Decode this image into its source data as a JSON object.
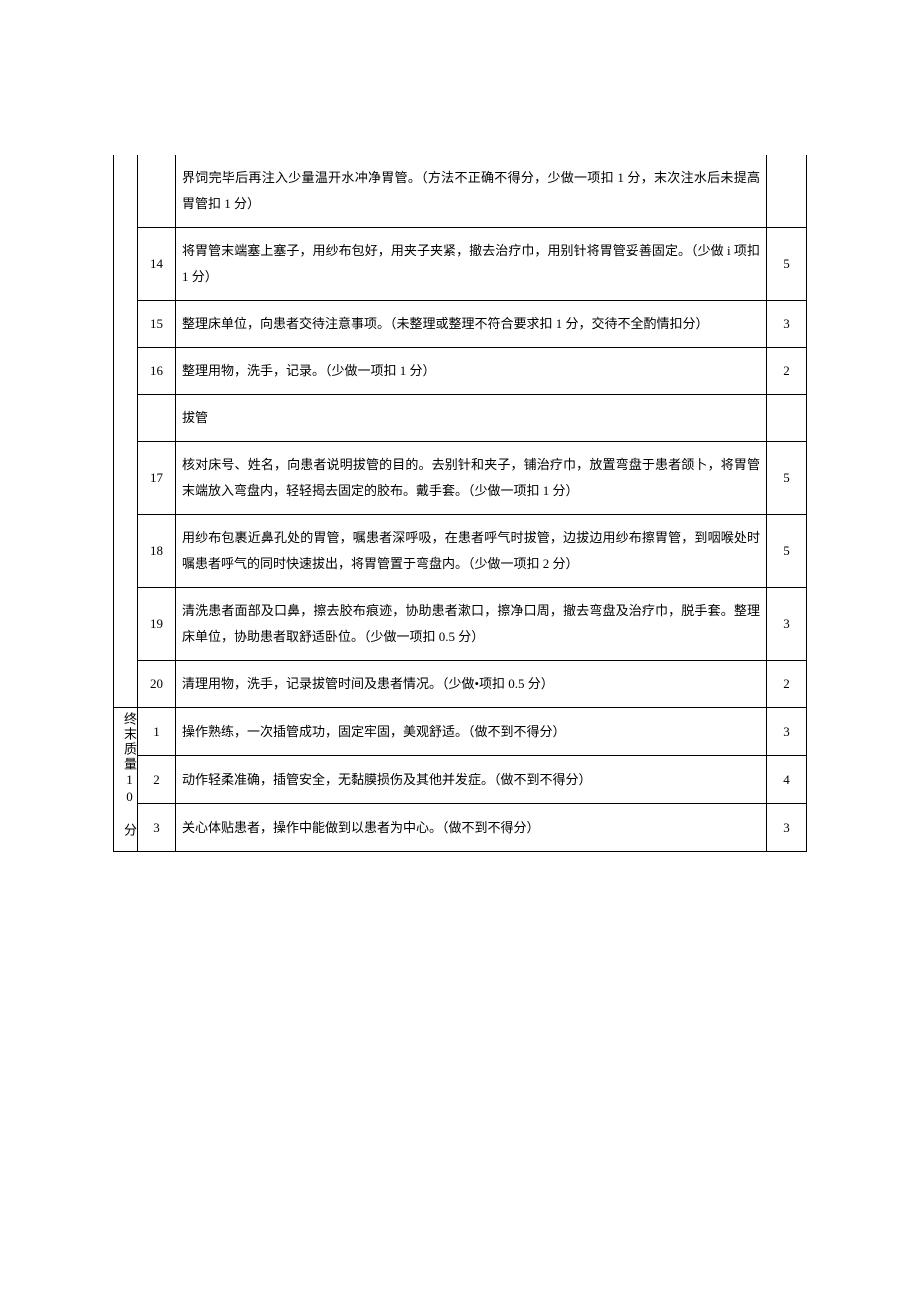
{
  "sections": {
    "main_continued": {
      "rows": [
        {
          "num": "",
          "content": "界饲完毕后再注入少量温开水冲净胃管。（方法不正确不得分，少做一项扣 1 分，末次注水后未提高胃管扣 1 分）",
          "score": ""
        },
        {
          "num": "14",
          "content": "将胃管末端塞上塞子，用纱布包好，用夹子夹紧，撤去治疗巾，用别针将胃管妥善固定。（少做 i 项扣 1 分）",
          "score": "5"
        },
        {
          "num": "15",
          "content": "整理床单位，向患者交待注意事项。（未整理或整理不符合要求扣 1 分，交待不全酌情扣分）",
          "score": "3"
        },
        {
          "num": "16",
          "content": "整理用物，洗手，记录。（少做一项扣 1 分）",
          "score": "2"
        },
        {
          "num": "",
          "content": "拔管",
          "score": ""
        },
        {
          "num": "17",
          "content": "核对床号、姓名，向患者说明拔管的目的。去别针和夹子，铺治疗巾，放置弯盘于患者颌卜，将胃管末端放入弯盘内，轻轻揭去固定的胶布。戴手套。（少做一项扣 1 分）",
          "score": "5"
        },
        {
          "num": "18",
          "content": "用纱布包裹近鼻孔处的胃管，嘱患者深呼吸，在患者呼气时拔管，边拔边用纱布擦胃管，到咽喉处时嘱患者呼气的同时快速拔出，将胃管置于弯盘内。（少做一项扣 2 分）",
          "score": "5"
        },
        {
          "num": "19",
          "content": "清洗患者面部及口鼻，擦去胶布痕迹，协助患者漱口，擦净口周，撤去弯盘及治疗巾，脱手套。整理床单位，协助患者取舒适卧位。（少做一项扣 0.5 分）",
          "score": "3"
        },
        {
          "num": "20",
          "content": "清理用物，洗手，记录拔管时间及患者情况。（少做•项扣 0.5 分）",
          "score": "2"
        }
      ]
    },
    "final_quality": {
      "label": "终末质量10 分",
      "rows": [
        {
          "num": "1",
          "content": "操作熟练，一次插管成功，固定牢固，美观舒适。（做不到不得分）",
          "score": "3"
        },
        {
          "num": "2",
          "content": "动作轻柔准确，插管安全，无黏膜损伤及其他并发症。（做不到不得分）",
          "score": "4"
        },
        {
          "num": "3",
          "content": "关心体贴患者，操作中能做到以患者为中心。（做不到不得分）",
          "score": "3"
        }
      ]
    }
  }
}
